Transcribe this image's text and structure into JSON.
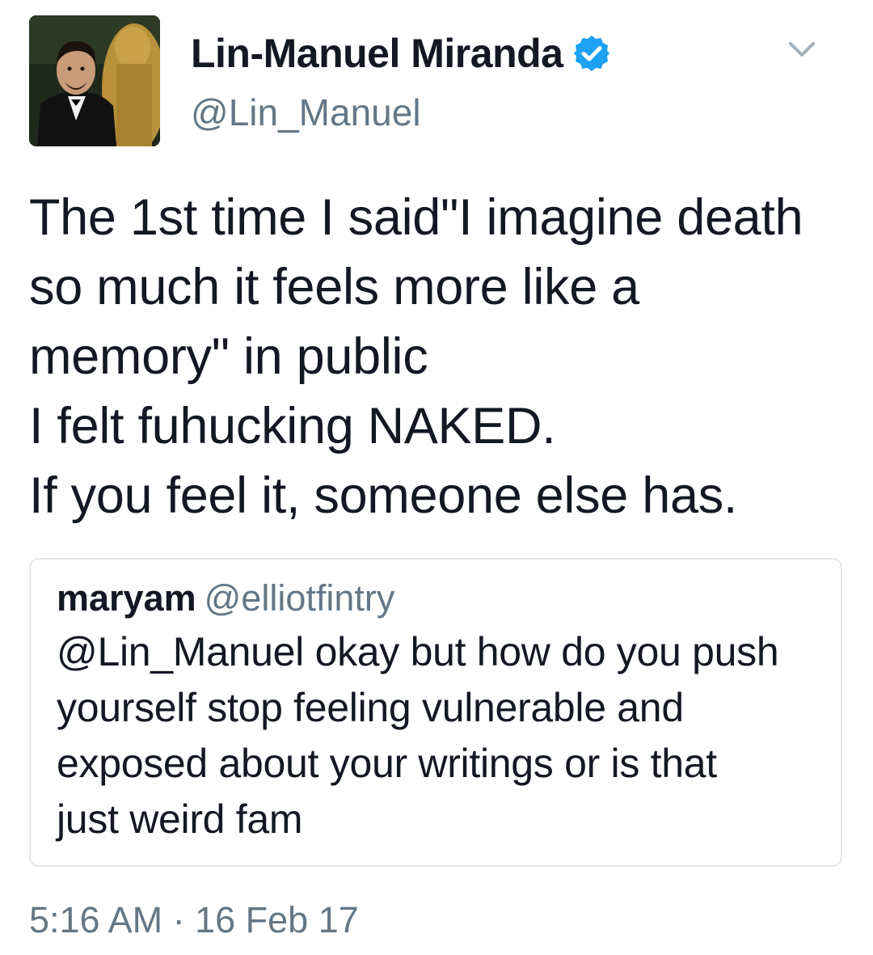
{
  "tweet": {
    "author": {
      "display_name": "Lin-Manuel Miranda",
      "handle": "@Lin_Manuel",
      "verified": true,
      "avatar_icon": "profile-photo"
    },
    "menu_icon": "chevron-down-icon",
    "text_lines": [
      "The 1st time I said\"I imagine death",
      "so much it feels more like a",
      "memory\" in public",
      "I felt fuhucking NAKED.",
      "If you feel it, someone else has."
    ],
    "quoted_tweet": {
      "display_name": "maryam",
      "handle": "@elliotfintry",
      "text_lines": [
        "@Lin_Manuel okay but how do you push",
        "yourself stop feeling vulnerable and",
        "exposed about your writings or is that",
        "just weird fam"
      ]
    },
    "timestamp": "5:16 AM · 16 Feb 17"
  },
  "colors": {
    "text_primary": "#141823",
    "text_secondary": "#657786",
    "verified_blue": "#1da1f2",
    "card_border": "#e1e8ed"
  }
}
